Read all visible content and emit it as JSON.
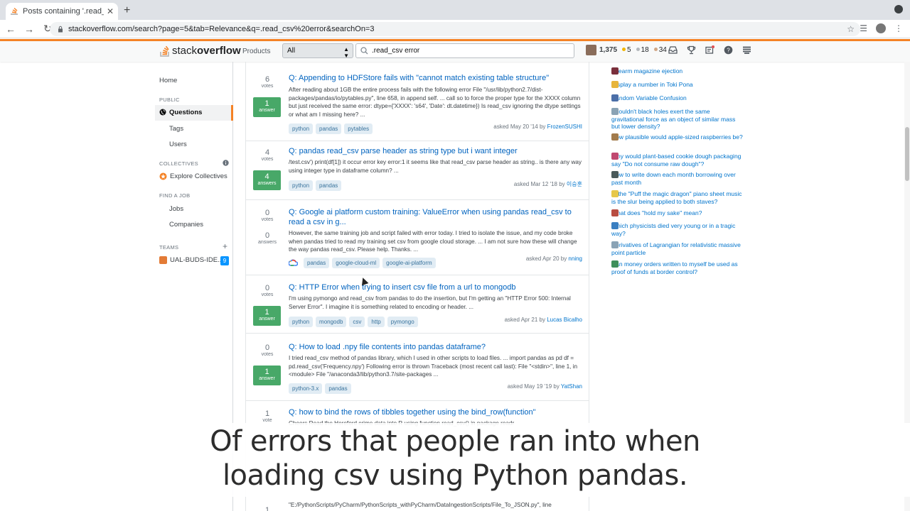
{
  "browser": {
    "tab_title": "Posts containing '.read_csv err",
    "url": "stackoverflow.com/search?page=5&tab=Relevance&q=.read_csv%20error&searchOn=3"
  },
  "header": {
    "logo_stack": "stack",
    "logo_overflow": "overflow",
    "products": "Products",
    "scope": "All",
    "search_value": ".read_csv error",
    "reputation": "1,375",
    "gold": "5",
    "silver": "18",
    "bronze": "34",
    "colors": {
      "accent": "#f48225",
      "gold": "#f1b600",
      "silver": "#b4b8bc",
      "bronze": "#d1a684"
    }
  },
  "sidebar": {
    "home": "Home",
    "public": "PUBLIC",
    "questions": "Questions",
    "tags": "Tags",
    "users": "Users",
    "collectives": "COLLECTIVES",
    "explore": "Explore Collectives",
    "find_job": "FIND A JOB",
    "jobs": "Jobs",
    "companies": "Companies",
    "teams": "TEAMS",
    "team_name": "UAL-BUDS-IDE...",
    "team_badge": "9"
  },
  "results": [
    {
      "votes": "6",
      "votes_label": "votes",
      "answers": "1",
      "answers_label": "answer",
      "accepted": true,
      "title": "Q: Appending to HDFStore fails with \"cannot match existing table structure\"",
      "excerpt": "After reading about 1GB the entire process fails with the following error File \"/usr/lib/python2.7/dist-packages/pandas/io/pytables.py\", line 658, in append self. ... call so to force the proper type for the XXXX column but just received the same error: dtype={'XXXX': 's64', 'Date': dt.datetime}) Is read_csv ignoring the dtype settings or what am I missing here? ...",
      "tags": [
        "python",
        "pandas",
        "pytables"
      ],
      "asked": "asked May 20 '14 by ",
      "user": "FrozenSUSHI"
    },
    {
      "votes": "4",
      "votes_label": "votes",
      "answers": "4",
      "answers_label": "answers",
      "accepted": true,
      "title": "Q: pandas read_csv parse header as string type but i want integer",
      "excerpt": "/test.csv') print(df[1]) it occur error key error:1 it seems like that read_csv parse header as string.. is there any way using integer type in dataframe column? ...",
      "tags": [
        "python",
        "pandas"
      ],
      "asked": "asked Mar 12 '18 by ",
      "user": "이승훈"
    },
    {
      "votes": "0",
      "votes_label": "votes",
      "answers": "0",
      "answers_label": "answers",
      "accepted": false,
      "title": "Q: Google ai platform custom training: ValueError when using pandas read_csv to read a csv in g...",
      "excerpt": "However, the same training job and script failed with error today. I tried to isolate the issue, and my code broke when pandas tried to read my training set csv from google cloud storage. ... I am not sure how these will change the way pandas read_csv. Please help. Thanks. ...",
      "tags": [
        "pandas",
        "google-cloud-ml",
        "google-ai-platform"
      ],
      "asked": "asked Apr 20 by ",
      "user": "nning"
    },
    {
      "votes": "0",
      "votes_label": "votes",
      "answers": "1",
      "answers_label": "answer",
      "accepted": true,
      "title": "Q: HTTP Error when trying to insert csv file from a url to mongodb",
      "excerpt": "I'm using pymongo and read_csv from pandas to do the insertion, but I'm getting an \"HTTP Error 500: Internal Server Error\". I imagine it is something related to encoding or header. ...",
      "tags": [
        "python",
        "mongodb",
        "csv",
        "http",
        "pymongo"
      ],
      "asked": "asked Apr 21 by ",
      "user": "Lucas Bicalho"
    },
    {
      "votes": "0",
      "votes_label": "votes",
      "answers": "1",
      "answers_label": "answer",
      "accepted": true,
      "title": "Q: How to load .npy file contents into pandas dataframe?",
      "excerpt": "I tried read_csv method of pandas library, which I used in other scripts to load files. ... import pandas as pd df = pd.read_csv('Frequency.npy') Following error is thrown Traceback (most recent call last): File \"<stdin>\", line 1, in <module> File \"/anaconda3/lib/python3.7/site-packages ...",
      "tags": [
        "python-3.x",
        "pandas"
      ],
      "asked": "asked May 19 '19 by ",
      "user": "YatShan"
    },
    {
      "votes": "1",
      "votes_label": "vote",
      "title": "Q: how to bind the rows of tibbles together using the bind_row(function\"",
      "excerpt": "Cheers Read the Hereford crime data into R using function read_csv() in package readr"
    },
    {
      "votes": "1",
      "excerpt": "\"E:/PythonScripts/PyCharm/PythonScripts_withPyCharm/DataIngestionScripts/File_To_JSON.py\", line"
    }
  ],
  "hot": [
    "Firearm magazine ejection",
    "Display a number in Toki Pona",
    "Random Variable Confusion",
    "Shouldn't black holes exert the same gravitational force as an object of similar mass but lower density?",
    "How plausible would apple-sized raspberries be?",
    "Why would plant-based cookie dough packaging say \"Do not consume raw dough\"?",
    "How to write down each month borrowing over past month",
    "In the \"Puff the magic dragon\" piano sheet music is the slur being applied to both staves?",
    "What does \"hold my sake\" mean?",
    "Which physicists died very young or in a tragic way?",
    "Derivatives of Lagrangian for relativistic massive point particle",
    "Can money orders written to myself be used as proof of funds at border control?"
  ],
  "caption": {
    "line1": "Of errors that people ran into when",
    "line2": "loading csv using Python pandas."
  }
}
